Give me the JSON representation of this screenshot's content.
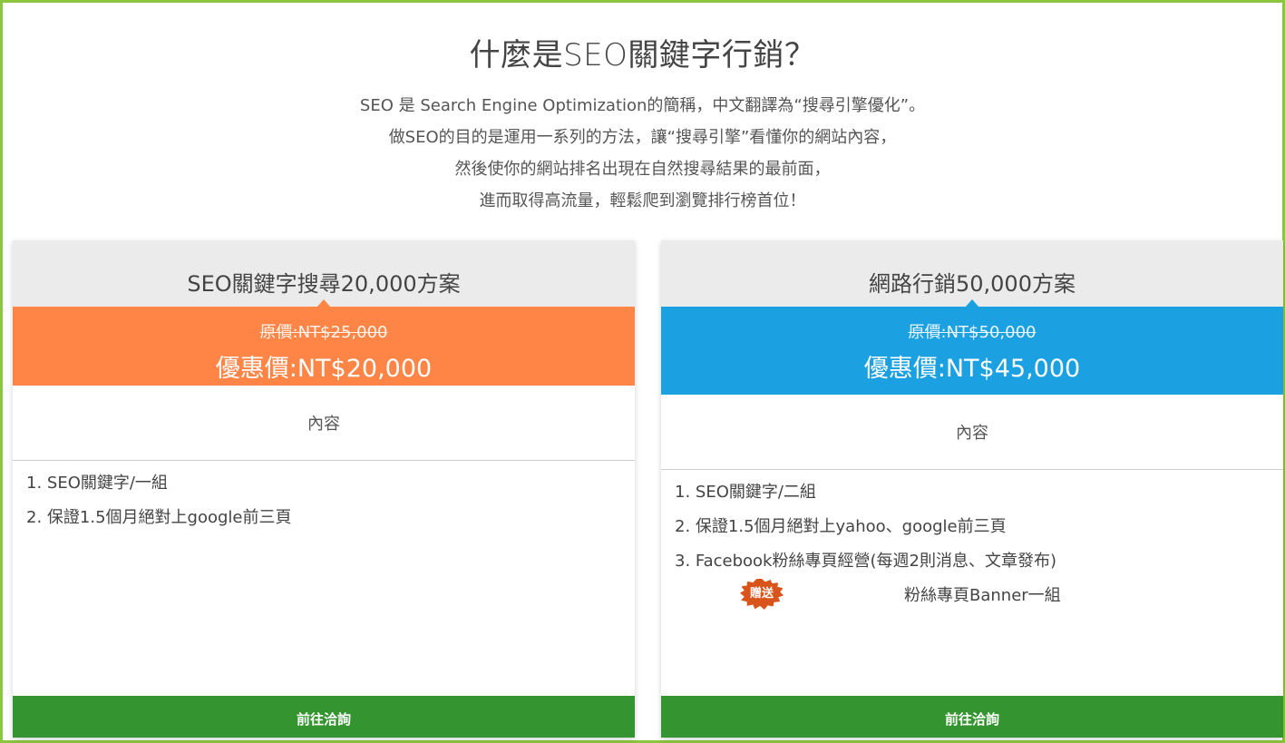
{
  "header": {
    "title": "什麼是SEO關鍵字行銷？",
    "intro_lines": [
      "SEO 是 Search Engine Optimization的簡稱，中文翻譯為“搜尋引擎優化”。",
      "做SEO的目的是運用一系列的方法，讓“搜尋引擎”看懂你的網站內容，",
      "然後使你的網站排名出現在自然搜尋結果的最前面，",
      "進而取得高流量，輕鬆爬到瀏覽排行榜首位！"
    ]
  },
  "plans": [
    {
      "name": "SEO關鍵字搜尋20,000方案",
      "original_price": "原價:NT$25,000",
      "sale_price": "優惠價:NT$20,000",
      "content_label": "內容",
      "features": [
        "1. SEO關鍵字/一組",
        "2. 保證1.5個月絕對上google前三頁"
      ],
      "cta_label": "前往洽詢",
      "accent_color": "#ff8547"
    },
    {
      "name": "網路行銷50,000方案",
      "original_price": "原價:NT$50,000",
      "sale_price": "優惠價:NT$45,000",
      "content_label": "內容",
      "features": [
        "1. SEO關鍵字/二組",
        "2. 保證1.5個月絕對上yahoo、google前三頁",
        "3. Facebook粉絲專頁經營(每週2則消息、文章發布)"
      ],
      "gift_badge": "贈送",
      "gift_text": "粉絲專頁Banner一組",
      "cta_label": "前往洽詢",
      "accent_color": "#1ba0e1"
    }
  ],
  "colors": {
    "border": "#8cc63f",
    "cta": "#34942f",
    "card_header": "#ebebeb"
  }
}
